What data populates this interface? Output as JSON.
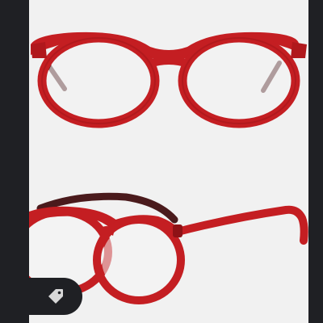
{
  "viewer": {
    "background": "#1f2024",
    "card_background": "#f1f1f1"
  },
  "product": {
    "frame_color": "#c41e22",
    "temple_inner_color": "#4a1a1c",
    "images": [
      {
        "view": "front",
        "icon": "eyeglasses-front-image"
      },
      {
        "view": "side",
        "icon": "eyeglasses-side-image"
      }
    ]
  },
  "tag_button": {
    "icon": "tag-icon",
    "icon_color": "#d8d8d8"
  }
}
